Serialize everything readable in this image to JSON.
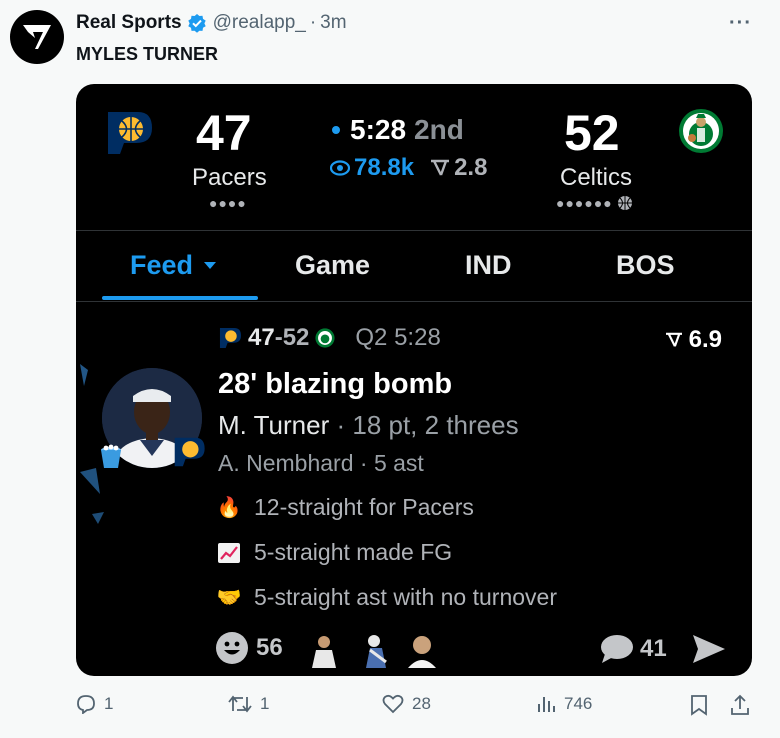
{
  "post": {
    "author": "Real Sports",
    "handle": "@realapp_",
    "separator": "·",
    "time": "3m",
    "text": "MYLES TURNER",
    "more_icon": "more-horizontal-icon"
  },
  "scoreboard": {
    "away": {
      "score": "47",
      "name": "Pacers",
      "dots": "●●●●"
    },
    "home": {
      "score": "52",
      "name": "Celtics",
      "dots": "●●●●●●"
    },
    "clock": "5:28",
    "period": "2nd",
    "viewers": "78.8k",
    "hot": "2.8"
  },
  "tabs": [
    {
      "label": "Feed"
    },
    {
      "label": "Game"
    },
    {
      "label": "IND"
    },
    {
      "label": "BOS"
    }
  ],
  "play": {
    "score_away": "47",
    "score_sep": "-52",
    "quarter": "Q2 5:28",
    "hot": "6.9",
    "title": "28' blazing bomb",
    "player": "M. Turner",
    "stats": " · 18 pt, 2 threes",
    "assist": "A. Nembhard · 5 ast",
    "streaks": [
      {
        "icon": "fire-icon",
        "text": "12-straight for Pacers"
      },
      {
        "icon": "chart-up-icon",
        "text": "5-straight made FG"
      },
      {
        "icon": "handshake-icon",
        "text": "5-straight ast with no turnover"
      }
    ],
    "reactions": "56",
    "comments": "41"
  },
  "actions": {
    "replies": "1",
    "reposts": "1",
    "likes": "28",
    "views": "746"
  },
  "colors": {
    "accent": "#1d9bf0",
    "card_bg": "#000000",
    "page_bg": "#f7f9f9",
    "pacers_navy": "#002d62",
    "pacers_gold": "#fdbb30",
    "celtics_green": "#007a33"
  }
}
